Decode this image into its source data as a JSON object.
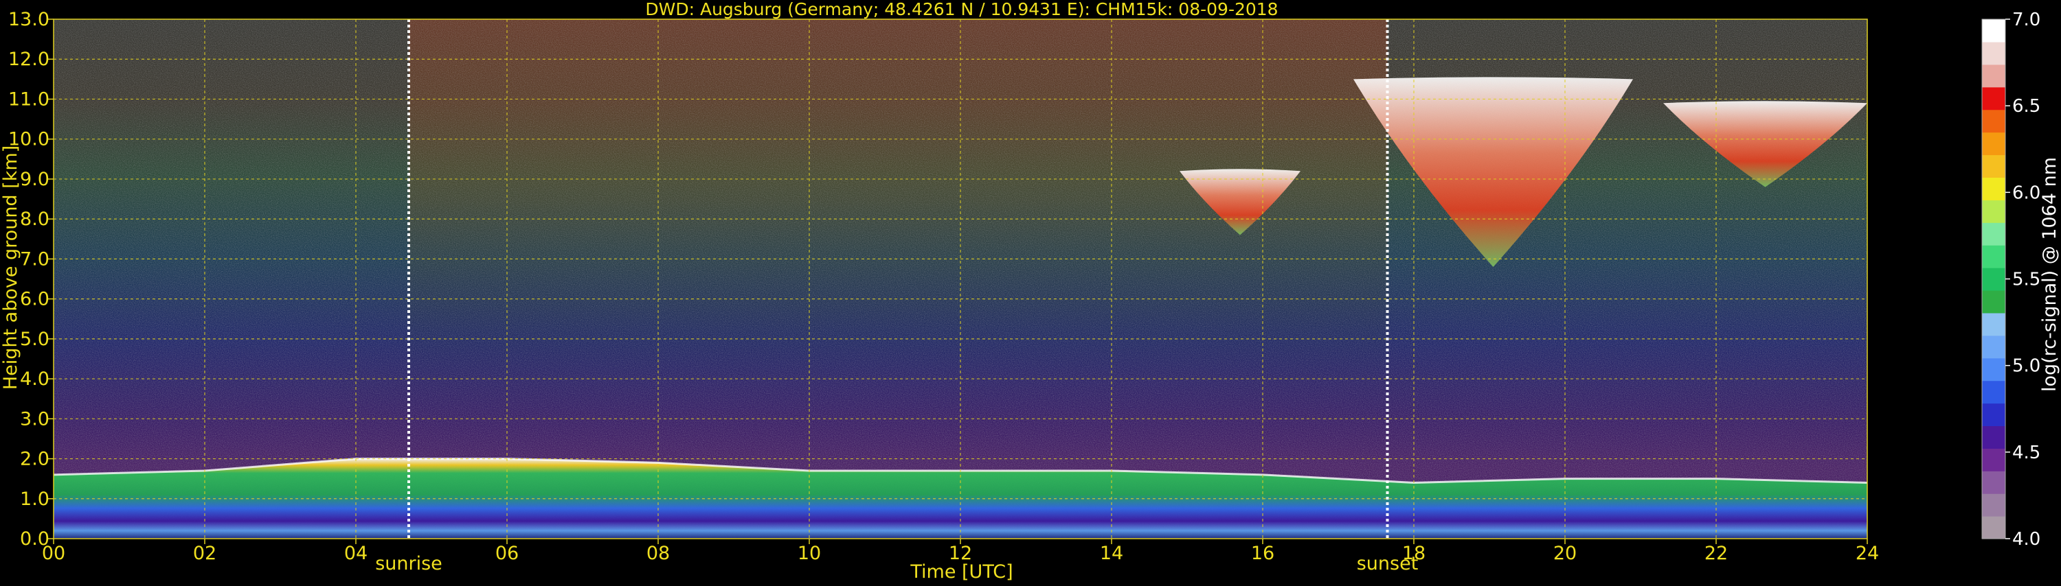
{
  "chart_data": {
    "type": "heatmap",
    "title": "DWD: Augsburg (Germany; 48.4261 N / 10.9431 E):    CHM15k: 08-09-2018",
    "xlabel": "Time [UTC]",
    "ylabel": "Height above ground [km]",
    "colorbar_label": "log(rc-signal) @ 1064 nm",
    "xlim": [
      0,
      24
    ],
    "ylim": [
      0,
      13
    ],
    "x_ticks": [
      0,
      2,
      4,
      6,
      8,
      10,
      12,
      14,
      16,
      18,
      20,
      22,
      24
    ],
    "x_tick_labels": [
      "00",
      "02",
      "04",
      "06",
      "08",
      "10",
      "12",
      "14",
      "16",
      "18",
      "20",
      "22",
      "24"
    ],
    "y_ticks": [
      0,
      1,
      2,
      3,
      4,
      5,
      6,
      7,
      8,
      9,
      10,
      11,
      12,
      13
    ],
    "y_tick_labels": [
      "0.0",
      "1.0",
      "2.0",
      "3.0",
      "4.0",
      "5.0",
      "6.0",
      "7.0",
      "8.0",
      "9.0",
      "10.0",
      "11.0",
      "12.0",
      "13.0"
    ],
    "grid": true,
    "colorbar_range": [
      4.0,
      7.0
    ],
    "colorbar_ticks": [
      4.0,
      4.5,
      5.0,
      5.5,
      6.0,
      6.5,
      7.0
    ],
    "colorbar_tick_labels": [
      "4.0",
      "4.5",
      "5.0",
      "5.5",
      "6.0",
      "6.5",
      "7.0"
    ],
    "colorbar_colors": [
      "#a99aa6",
      "#9b7fa3",
      "#8a5aa0",
      "#6e2a95",
      "#4a1a9c",
      "#2a2fc8",
      "#2f5ae6",
      "#4f8af5",
      "#6fa8f6",
      "#8ec2f2",
      "#2fae45",
      "#20c060",
      "#3fd878",
      "#7de8a0",
      "#b8ea50",
      "#f2ea20",
      "#f5c020",
      "#f59a10",
      "#f06410",
      "#e61010",
      "#e8a8a0",
      "#f0d8d4",
      "#ffffff"
    ],
    "markers": [
      {
        "time": 4.7,
        "label": "sunrise"
      },
      {
        "time": 17.65,
        "label": "sunset"
      }
    ],
    "cloud_layers": [
      {
        "start": 14.9,
        "end": 16.5,
        "base_km": 7.6,
        "top_km": 9.2
      },
      {
        "start": 17.2,
        "end": 20.9,
        "base_km": 6.8,
        "top_km": 11.5
      },
      {
        "start": 21.3,
        "end": 24.0,
        "base_km": 8.8,
        "top_km": 10.9
      }
    ],
    "boundary_layer_top_km": [
      {
        "time": 0,
        "value": 1.6
      },
      {
        "time": 2,
        "value": 1.7
      },
      {
        "time": 4,
        "value": 2.0
      },
      {
        "time": 6,
        "value": 2.0
      },
      {
        "time": 8,
        "value": 1.9
      },
      {
        "time": 10,
        "value": 1.7
      },
      {
        "time": 12,
        "value": 1.7
      },
      {
        "time": 14,
        "value": 1.7
      },
      {
        "time": 16,
        "value": 1.6
      },
      {
        "time": 18,
        "value": 1.4
      },
      {
        "time": 20,
        "value": 1.5
      },
      {
        "time": 22,
        "value": 1.5
      },
      {
        "time": 24,
        "value": 1.4
      }
    ]
  }
}
